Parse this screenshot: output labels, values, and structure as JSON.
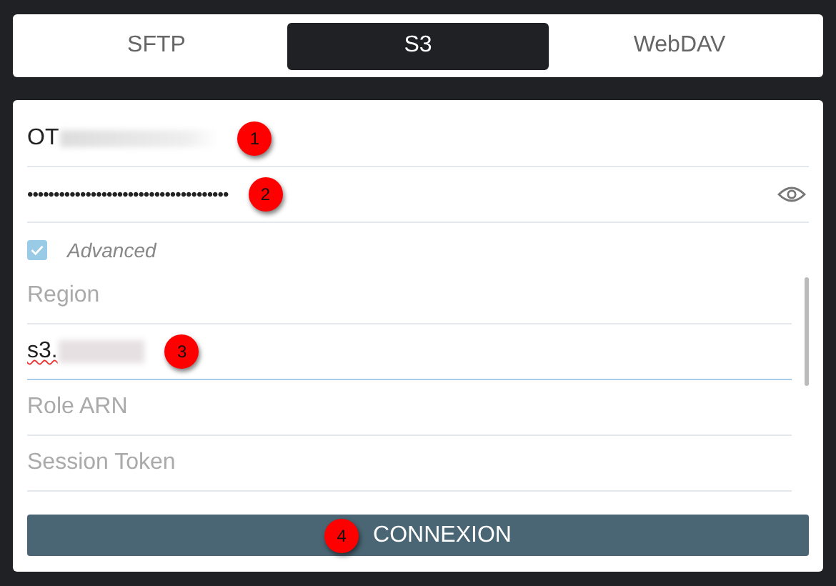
{
  "tabs": [
    {
      "label": "SFTP",
      "selected": false
    },
    {
      "label": "S3",
      "selected": true
    },
    {
      "label": "WebDAV",
      "selected": false
    }
  ],
  "fields": [
    {
      "kind": "text",
      "value": "OT",
      "redacted": true,
      "marker": "1"
    },
    {
      "kind": "password",
      "value": "••••••••••••••••••••••••••••••••••••••",
      "marker": "2"
    }
  ],
  "advanced": {
    "label": "Advanced",
    "checked": true
  },
  "advanced_fields": [
    {
      "placeholder": "Region"
    },
    {
      "value": "s3.",
      "redacted": true,
      "focused": true,
      "misspelled": true,
      "marker": "3"
    },
    {
      "placeholder": "Role ARN"
    },
    {
      "placeholder": "Session Token"
    }
  ],
  "button": {
    "label": "CONNEXION",
    "marker": "4"
  }
}
